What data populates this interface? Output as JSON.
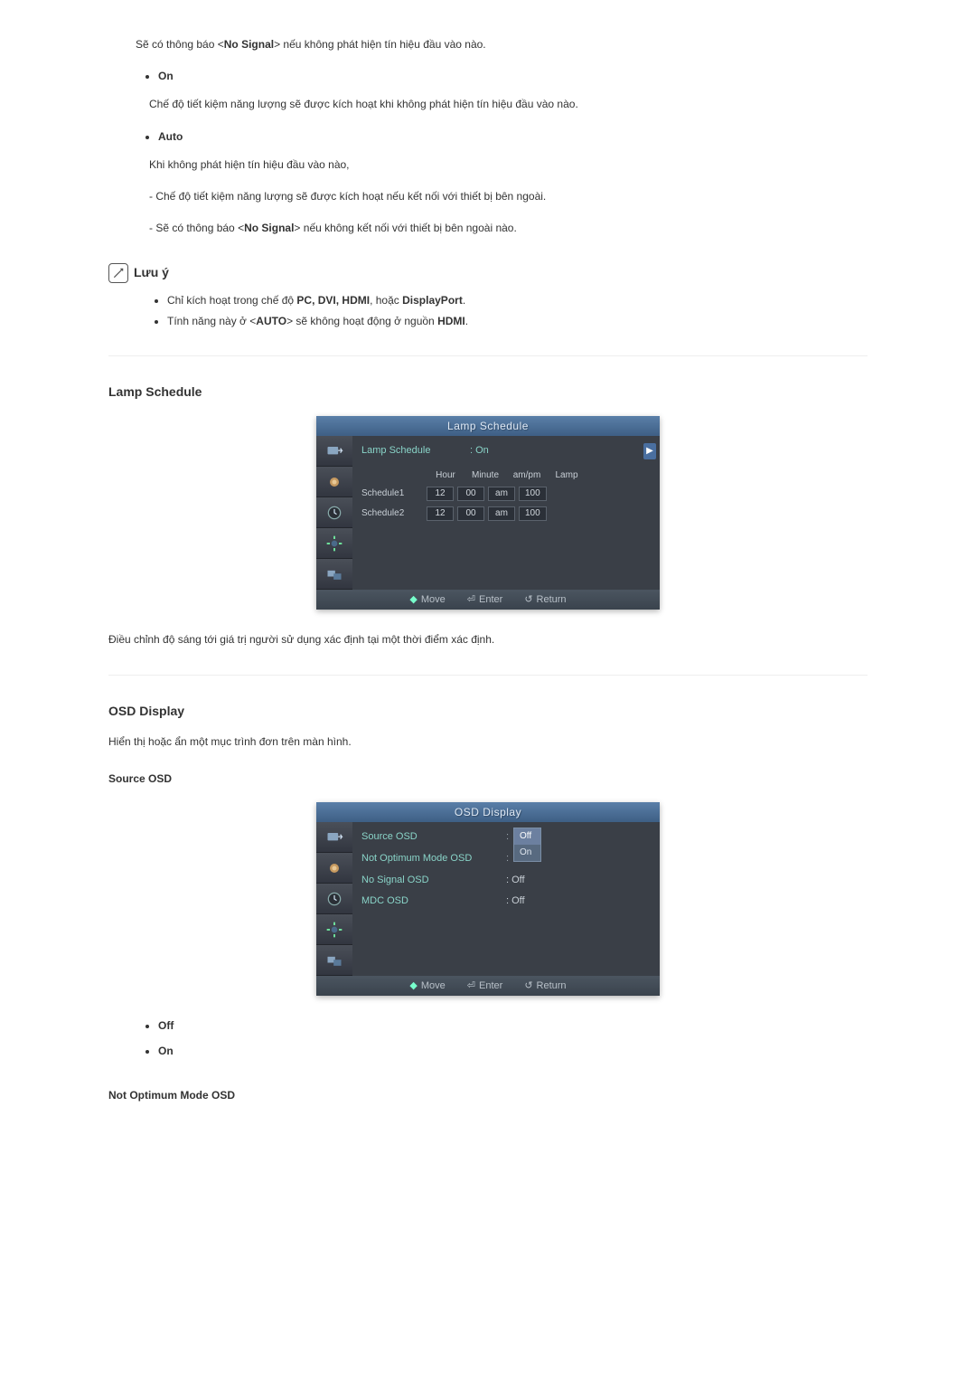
{
  "intro": {
    "no_signal_text_pre": "Sẽ có thông báo <",
    "no_signal_bold": "No Signal",
    "no_signal_text_post": "> nếu không phát hiện tín hiệu đầu vào nào."
  },
  "bullets": {
    "on": {
      "label": "On",
      "desc": "Chế độ tiết kiệm năng lượng sẽ được kích hoạt khi không phát hiện tín hiệu đầu vào nào."
    },
    "auto": {
      "label": "Auto",
      "line1": "Khi không phát hiện tín hiệu đầu vào nào,",
      "line2": "- Chế độ tiết kiệm năng lượng sẽ được kích hoạt nếu kết nối với thiết bị bên ngoài.",
      "line3_pre": "- Sẽ có thông báo <",
      "line3_bold": "No Signal",
      "line3_post": "> nếu không kết nối với thiết bị bên ngoài nào."
    }
  },
  "note": {
    "label": "Lưu ý",
    "item1_pre": "Chỉ kích hoạt trong chế độ ",
    "item1_bold": "PC, DVI, HDMI",
    "item1_mid": ", hoặc ",
    "item1_bold2": "DisplayPort",
    "item1_post": ".",
    "item2_pre": "Tính năng này ở <",
    "item2_bold1": "AUTO",
    "item2_mid": "> sẽ không hoạt động ở nguồn ",
    "item2_bold2": "HDMI",
    "item2_post": "."
  },
  "lamp": {
    "title": "Lamp Schedule",
    "osd_title": "Lamp Schedule",
    "row_label": "Lamp Schedule",
    "row_value": ": On",
    "headers": {
      "hour": "Hour",
      "minute": "Minute",
      "ampm": "am/pm",
      "lamp": "Lamp"
    },
    "sched1": {
      "label": "Schedule1",
      "hour": "12",
      "minute": "00",
      "ampm": "am",
      "lamp": "100"
    },
    "sched2": {
      "label": "Schedule2",
      "hour": "12",
      "minute": "00",
      "ampm": "am",
      "lamp": "100"
    },
    "desc": "Điều chỉnh độ sáng tới giá trị người sử dụng xác định tại một thời điểm xác định."
  },
  "osd_display": {
    "title": "OSD Display",
    "desc": "Hiển thị hoặc ẩn một mục trình đơn trên màn hình.",
    "source_title": "Source OSD",
    "osd_title": "OSD Display",
    "rows": {
      "source": "Source OSD",
      "notopt": "Not Optimum Mode OSD",
      "nosig": "No Signal OSD",
      "mdc": "MDC OSD"
    },
    "vals": {
      "on": "On",
      "off": "Off",
      "coloff": ": Off",
      "colon": ": On"
    },
    "dropdown": {
      "off": "Off",
      "on": "On"
    },
    "list_off": "Off",
    "list_on": "On",
    "notopt_title": "Not Optimum Mode OSD"
  },
  "footer": {
    "move": "Move",
    "enter": "Enter",
    "return": "Return"
  }
}
